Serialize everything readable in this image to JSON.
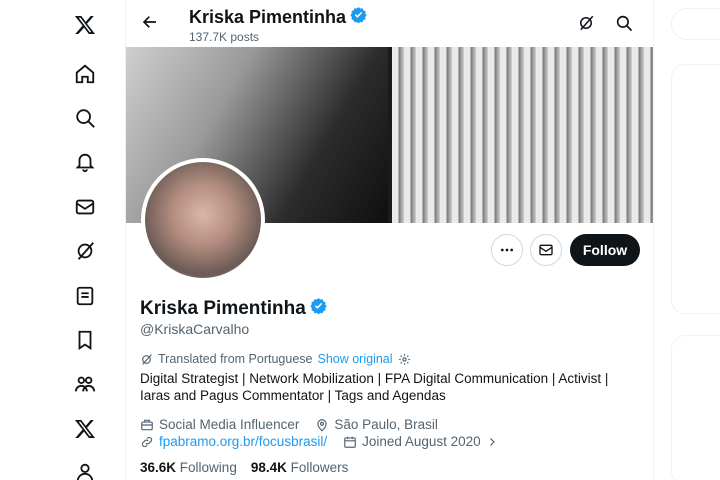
{
  "header": {
    "name": "Kriska Pimentinha",
    "posts": "137.7K posts"
  },
  "profile": {
    "name": "Kriska Pimentinha",
    "handle": "@KriskaCarvalho",
    "translated_from": "Translated from Portuguese",
    "show_original": "Show original",
    "bio": "Digital Strategist | Network Mobilization | FPA Digital Communication | Activist | Iaras and Pagus Commentator | Tags and Agendas",
    "category": "Social Media Influencer",
    "location": "São Paulo, Brasil",
    "website": "fpabramo.org.br/focusbrasil/",
    "joined": "Joined August 2020",
    "following_count": "36.6K",
    "following_label": "Following",
    "followers_count": "98.4K",
    "followers_label": "Followers"
  },
  "actions": {
    "follow_label": "Follow"
  },
  "icons": {
    "verified": "verified-badge-icon",
    "accent": "#1d9bf0"
  },
  "colors": {
    "text": "#0f1419",
    "secondary": "#536471",
    "link": "#1d9bf0",
    "follow_bg": "#0f1419"
  }
}
